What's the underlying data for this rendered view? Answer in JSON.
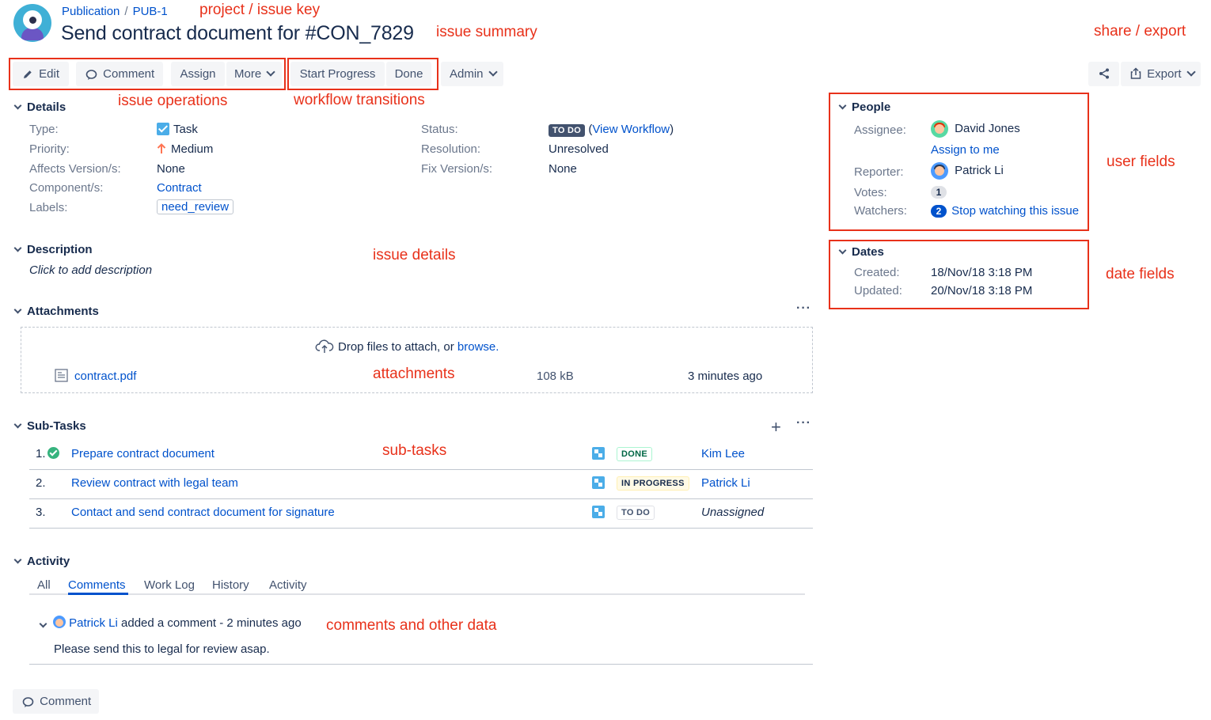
{
  "header": {
    "project": "Publication",
    "issue_key": "PUB-1",
    "summary": "Send contract document for #CON_7829"
  },
  "toolbar": {
    "edit": "Edit",
    "comment": "Comment",
    "assign": "Assign",
    "more": "More",
    "start_progress": "Start Progress",
    "done": "Done",
    "admin": "Admin",
    "export": "Export"
  },
  "details": {
    "heading": "Details",
    "type_label": "Type:",
    "type_value": "Task",
    "priority_label": "Priority:",
    "priority_value": "Medium",
    "affects_label": "Affects Version/s:",
    "affects_value": "None",
    "components_label": "Component/s:",
    "components_value": "Contract",
    "labels_label": "Labels:",
    "labels_value": "need_review",
    "status_label": "Status:",
    "status_value": "TO DO",
    "view_workflow": "View Workflow",
    "resolution_label": "Resolution:",
    "resolution_value": "Unresolved",
    "fix_label": "Fix Version/s:",
    "fix_value": "None"
  },
  "description": {
    "heading": "Description",
    "placeholder": "Click to add description"
  },
  "attachments": {
    "heading": "Attachments",
    "drop_text": "Drop files to attach, or",
    "browse": "browse.",
    "files": [
      {
        "name": "contract.pdf",
        "size": "108 kB",
        "time": "3 minutes ago"
      }
    ]
  },
  "subtasks": {
    "heading": "Sub-Tasks",
    "items": [
      {
        "num": "1.",
        "title": "Prepare contract document",
        "status": "DONE",
        "assignee": "Kim Lee"
      },
      {
        "num": "2.",
        "title": "Review contract with legal team",
        "status": "IN PROGRESS",
        "assignee": "Patrick Li"
      },
      {
        "num": "3.",
        "title": "Contact and send contract document for signature",
        "status": "TO DO",
        "assignee": "Unassigned"
      }
    ]
  },
  "activity": {
    "heading": "Activity",
    "tabs": [
      "All",
      "Comments",
      "Work Log",
      "History",
      "Activity"
    ],
    "active_tab": "Comments",
    "comment_author": "Patrick Li",
    "comment_meta": "added a comment - 2 minutes ago",
    "comment_body": "Please send this to legal for review asap.",
    "comment_button": "Comment"
  },
  "people": {
    "heading": "People",
    "assignee_label": "Assignee:",
    "assignee": "David Jones",
    "assign_to_me": "Assign to me",
    "reporter_label": "Reporter:",
    "reporter": "Patrick Li",
    "votes_label": "Votes:",
    "votes": "1",
    "watchers_label": "Watchers:",
    "watchers": "2",
    "stop_watching": "Stop watching this issue"
  },
  "dates": {
    "heading": "Dates",
    "created_label": "Created:",
    "created": "18/Nov/18 3:18 PM",
    "updated_label": "Updated:",
    "updated": "20/Nov/18 3:18 PM"
  },
  "annotations": {
    "project_key": "project / issue key",
    "summary": "issue summary",
    "share_export": "share / export",
    "operations": "issue operations",
    "workflow": "workflow transitions",
    "user_fields": "user fields",
    "issue_details": "issue details",
    "date_fields": "date fields",
    "attachments": "attachments",
    "subtasks": "sub-tasks",
    "comments": "comments and other data"
  },
  "colors": {
    "annotation_red": "#e8311a",
    "link_blue": "#0052cc",
    "text": "#172b4d",
    "muted": "#6b778c",
    "button_bg": "#f4f5f7"
  }
}
